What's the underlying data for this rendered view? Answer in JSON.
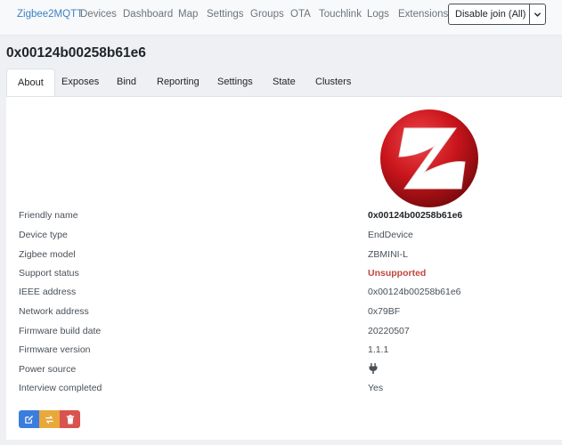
{
  "navbar": {
    "brand": "Zigbee2MQTT",
    "items": [
      "Devices",
      "Dashboard",
      "Map",
      "Settings",
      "Groups",
      "OTA",
      "Touchlink",
      "Logs",
      "Extensions"
    ],
    "join_button": "Disable join (All)",
    "join_caret_icon": "chevron-down-icon"
  },
  "page": {
    "title": "0x00124b00258b61e6"
  },
  "tabs": [
    "About",
    "Exposes",
    "Bind",
    "Reporting",
    "Settings",
    "State",
    "Clusters"
  ],
  "active_tab": "About",
  "device_image": {
    "icon": "zigbee-logo",
    "colors": {
      "primary": "#c8151b",
      "accent": "#ffffff"
    }
  },
  "details": [
    {
      "label": "Friendly name",
      "value": "0x00124b00258b61e6"
    },
    {
      "label": "Device type",
      "value": "EndDevice"
    },
    {
      "label": "Zigbee model",
      "value": "ZBMINI-L"
    },
    {
      "label": "Support status",
      "value": "Unsupported"
    },
    {
      "label": "IEEE address",
      "value": "0x00124b00258b61e6"
    },
    {
      "label": "Network address",
      "value": "0x79BF"
    },
    {
      "label": "Firmware build date",
      "value": "20220507"
    },
    {
      "label": "Firmware version",
      "value": "1.1.1"
    },
    {
      "label": "Power source",
      "value": "",
      "icon": "plug-icon"
    },
    {
      "label": "Interview completed",
      "value": "Yes"
    }
  ],
  "actions": {
    "edit_icon": "edit-icon",
    "interview_icon": "refresh-icon",
    "remove_icon": "trash-icon",
    "colors": {
      "edit": "#3b7ddd",
      "interview": "#e8a93b",
      "remove": "#d9534f"
    }
  }
}
